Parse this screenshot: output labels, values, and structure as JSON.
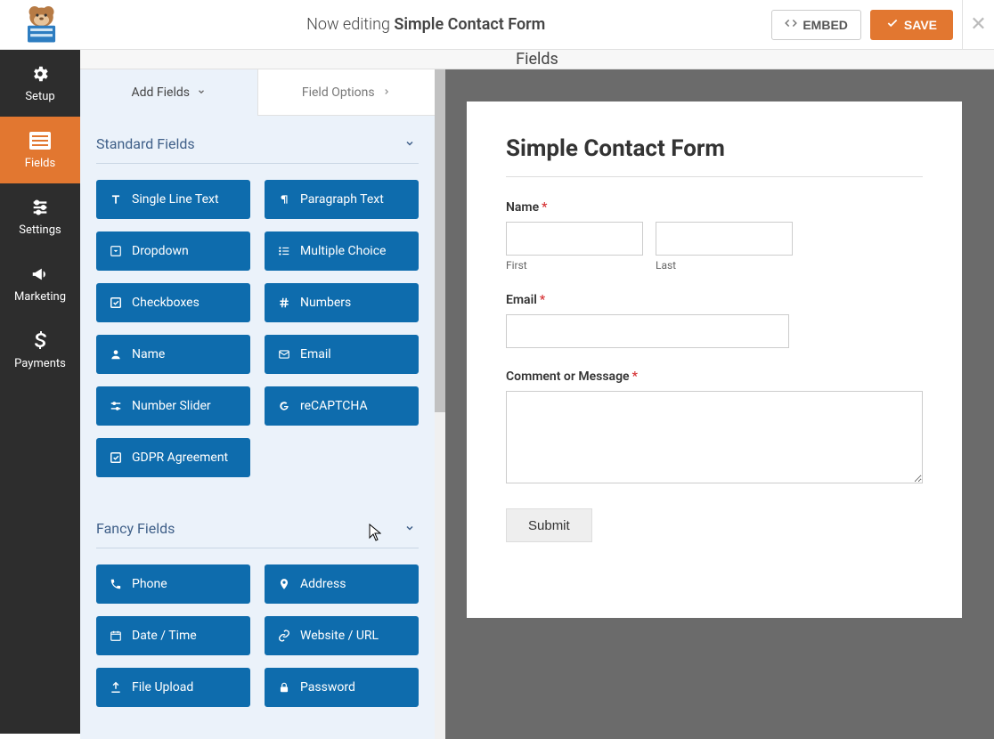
{
  "header": {
    "now_editing_prefix": "Now editing ",
    "form_name": "Simple Contact Form",
    "embed_label": "EMBED",
    "save_label": "SAVE"
  },
  "sidebar": {
    "items": [
      {
        "label": "Setup",
        "icon": "gear"
      },
      {
        "label": "Fields",
        "icon": "list"
      },
      {
        "label": "Settings",
        "icon": "sliders"
      },
      {
        "label": "Marketing",
        "icon": "bullhorn"
      },
      {
        "label": "Payments",
        "icon": "dollar"
      }
    ],
    "active_index": 1
  },
  "subheader": {
    "title": "Fields"
  },
  "tabs": {
    "add_fields": "Add Fields",
    "field_options": "Field Options",
    "active": "add_fields"
  },
  "field_panel": {
    "groups": [
      {
        "title": "Standard Fields",
        "fields": [
          {
            "label": "Single Line Text",
            "icon": "text"
          },
          {
            "label": "Paragraph Text",
            "icon": "paragraph"
          },
          {
            "label": "Dropdown",
            "icon": "caret-square"
          },
          {
            "label": "Multiple Choice",
            "icon": "list-ul"
          },
          {
            "label": "Checkboxes",
            "icon": "check-square"
          },
          {
            "label": "Numbers",
            "icon": "hashtag"
          },
          {
            "label": "Name",
            "icon": "user"
          },
          {
            "label": "Email",
            "icon": "envelope"
          },
          {
            "label": "Number Slider",
            "icon": "sliders-h"
          },
          {
            "label": "reCAPTCHA",
            "icon": "google"
          },
          {
            "label": "GDPR Agreement",
            "icon": "check-square"
          }
        ]
      },
      {
        "title": "Fancy Fields",
        "fields": [
          {
            "label": "Phone",
            "icon": "phone"
          },
          {
            "label": "Address",
            "icon": "map-marker"
          },
          {
            "label": "Date / Time",
            "icon": "calendar"
          },
          {
            "label": "Website / URL",
            "icon": "link"
          },
          {
            "label": "File Upload",
            "icon": "upload"
          },
          {
            "label": "Password",
            "icon": "lock"
          }
        ]
      }
    ]
  },
  "preview": {
    "form_title": "Simple Contact Form",
    "name_label": "Name",
    "first_sub": "First",
    "last_sub": "Last",
    "email_label": "Email",
    "message_label": "Comment or Message",
    "submit_label": "Submit"
  }
}
